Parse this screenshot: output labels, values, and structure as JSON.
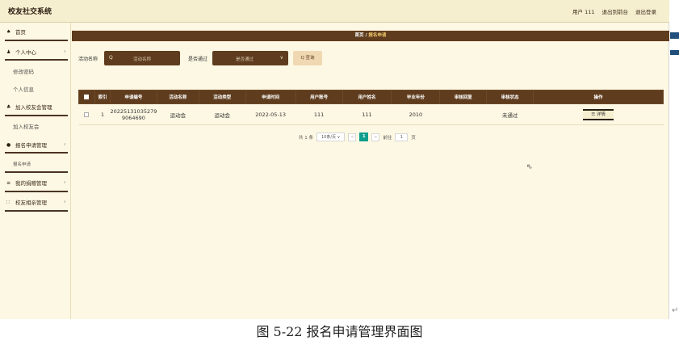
{
  "app": {
    "title": "校友社交系统",
    "top_links": [
      "用户 111",
      "退出到前台",
      "退出登录"
    ]
  },
  "sidebar": {
    "items": [
      {
        "icon": "home-icon",
        "glyph": "♠",
        "label": "首页",
        "sub": false,
        "chev": false
      },
      {
        "icon": "user-icon",
        "glyph": "♟",
        "label": "个人中心",
        "sub": false,
        "chev": true
      },
      {
        "label": "修改密码",
        "sub": true
      },
      {
        "label": "个人信息",
        "sub": true
      },
      {
        "icon": "group-icon",
        "glyph": "♣",
        "label": "加入校友会管理",
        "sub": false,
        "chev": true
      },
      {
        "label": "加入校友会",
        "sub": true
      },
      {
        "icon": "pin-icon",
        "glyph": "●",
        "label": "报名申请管理",
        "sub": false,
        "chev": true
      },
      {
        "label": "报名申请",
        "sub": true
      },
      {
        "icon": "list-icon",
        "glyph": "≡",
        "label": "我的捐赠管理",
        "sub": false,
        "chev": true
      },
      {
        "icon": "grid-icon",
        "glyph": "∷",
        "label": "校友相亲管理",
        "sub": false,
        "chev": true
      }
    ]
  },
  "breadcrumb": {
    "home": "首页",
    "sep": "/",
    "current": "报名申请"
  },
  "search": {
    "activity_label": "活动名称",
    "activity_placeholder": "活动名称",
    "passed_label": "是否通过",
    "passed_value": "是否通过",
    "query_button": "查询"
  },
  "table": {
    "headers": [
      "",
      "索引",
      "申请编号",
      "活动名称",
      "活动类型",
      "申请时间",
      "用户账号",
      "用户姓名",
      "毕业年份",
      "审核回复",
      "审核状态",
      "操作"
    ],
    "rows": [
      {
        "index": "1",
        "app_no_line1": "20225131035279",
        "app_no_line2": "9064690",
        "activity_name": "运动会",
        "activity_type": "运动会",
        "apply_time": "2022-05-13",
        "account": "111",
        "name": "111",
        "grad_year": "2010",
        "reply": "",
        "status": "未通过",
        "action": "详情"
      }
    ]
  },
  "pager": {
    "total": "共 1 条",
    "page_size": "10条/页",
    "prev": "<",
    "current": "1",
    "next": ">",
    "goto_label": "前往",
    "goto_value": "1",
    "page_unit": "页"
  },
  "caption": "图 5-22 报名申请管理界面图"
}
